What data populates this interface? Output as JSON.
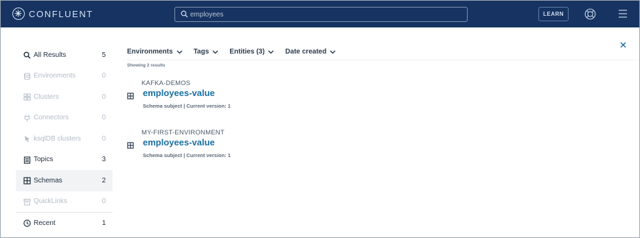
{
  "header": {
    "logo_text": "CONFLUENT",
    "search_value": "employees",
    "learn_label": "LEARN"
  },
  "sidebar": {
    "items": [
      {
        "label": "All Results",
        "count": "5",
        "icon": "search-icon",
        "state": "enabled"
      },
      {
        "label": "Environments",
        "count": "0",
        "icon": "environments-icon",
        "state": "disabled"
      },
      {
        "label": "Clusters",
        "count": "0",
        "icon": "clusters-icon",
        "state": "disabled"
      },
      {
        "label": "Connectors",
        "count": "0",
        "icon": "connectors-icon",
        "state": "disabled"
      },
      {
        "label": "ksqlDB clusters",
        "count": "0",
        "icon": "ksqldb-icon",
        "state": "disabled"
      },
      {
        "label": "Topics",
        "count": "3",
        "icon": "topics-icon",
        "state": "enabled"
      },
      {
        "label": "Schemas",
        "count": "2",
        "icon": "schemas-icon",
        "state": "active"
      },
      {
        "label": "QuickLinks",
        "count": "0",
        "icon": "quicklinks-icon",
        "state": "disabled"
      },
      {
        "label": "Recent",
        "count": "1",
        "icon": "clock-icon",
        "state": "enabled"
      }
    ]
  },
  "filters": [
    {
      "label": "Environments"
    },
    {
      "label": "Tags"
    },
    {
      "label": "Entities (3)"
    },
    {
      "label": "Date created"
    }
  ],
  "results_summary": "Showing 2 results",
  "results": [
    {
      "environment": "KAFKA-DEMOS",
      "title": "employees-value",
      "subtitle": "Schema subject | Current version: 1"
    },
    {
      "environment": "MY-FIRST-ENVIRONMENT",
      "title": "employees-value",
      "subtitle": "Schema subject | Current version: 1"
    }
  ],
  "colors": {
    "topbar": "#173361",
    "link": "#1a6fa3",
    "active_row": "#f1f3f5"
  }
}
